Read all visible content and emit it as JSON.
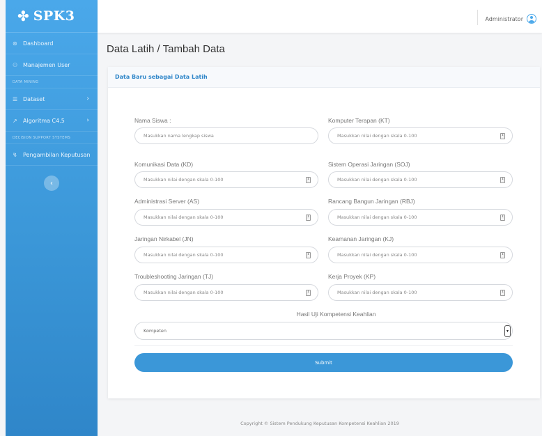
{
  "brand": {
    "icon": "✤",
    "name": "SPK3"
  },
  "sidebar": {
    "items": [
      {
        "icon": "⊛",
        "label": "Dashboard"
      },
      {
        "icon": "⚇",
        "label": "Manajemen User"
      }
    ],
    "section1": "DATA MINING",
    "mining_items": [
      {
        "icon": "☰",
        "label": "Dataset",
        "chevron": "›"
      },
      {
        "icon": "↗",
        "label": "Algoritma C4.5",
        "chevron": "›"
      }
    ],
    "section2": "DECISION SUPPORT SYSTEMS",
    "dss_items": [
      {
        "icon": "↯",
        "label": "Pengambilan Keputusan"
      }
    ],
    "toggle": "‹"
  },
  "topbar": {
    "user": "Administrator"
  },
  "page": {
    "title": "Data Latih / Tambah Data"
  },
  "card": {
    "header": "Data Baru sebagai Data Latih"
  },
  "form": {
    "nama_label": "Nama Siswa :",
    "nama_placeholder": "Masukkan nama lengkap siswa",
    "kt_label": "Komputer Terapan (KT)",
    "kd_label": "Komunikasi Data (KD)",
    "soj_label": "Sistem Operasi Jaringan (SOJ)",
    "as_label": "Administrasi Server (AS)",
    "rbj_label": "Rancang Bangun Jaringan (RBJ)",
    "jn_label": "Jaringan Nirkabel (JN)",
    "kj_label": "Keamanan Jaringan (KJ)",
    "tj_label": "Troubleshooting Jaringan (TJ)",
    "kp_label": "Kerja Proyek (KP)",
    "score_placeholder": "Masukkan nilai dengan skala 0-100",
    "spin_glyph": "⇕",
    "hasil_label": "Hasil Uji Kompetensi Keahlian",
    "hasil_value": "Kompeten",
    "select_arrow": "▾",
    "submit": "Submit"
  },
  "footer": "Copyright © Sistem Pendukung Keputusan Kompetensi Keahlian 2019"
}
